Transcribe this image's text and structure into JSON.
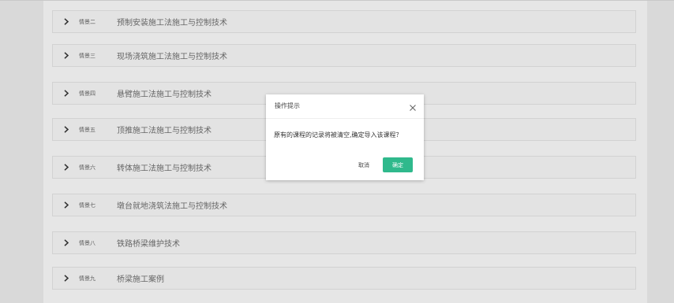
{
  "modules": [
    {
      "tag": "情景二",
      "title": "预制安装施工法施工与控制技术"
    },
    {
      "tag": "情景三",
      "title": "现场浇筑施工法施工与控制技术"
    },
    {
      "tag": "情景四",
      "title": "悬臂施工法施工与控制技术"
    },
    {
      "tag": "情景五",
      "title": "顶推施工法施工与控制技术"
    },
    {
      "tag": "情景六",
      "title": "转体施工法施工与控制技术"
    },
    {
      "tag": "情景七",
      "title": "墩台就地浇筑法施工与控制技术"
    },
    {
      "tag": "情景八",
      "title": "铁路桥梁维护技术"
    },
    {
      "tag": "情景九",
      "title": "桥梁施工案例"
    }
  ],
  "dialog": {
    "title": "操作提示",
    "message": "原有的课程的记录将被清空,确定导入该课程？",
    "cancel_label": "取消",
    "confirm_label": "确定",
    "close_icon": "close-icon"
  },
  "colors": {
    "confirm": "#2fb98c",
    "row_bg": "#e3e3e3",
    "side_bg": "#d9d9d9"
  }
}
